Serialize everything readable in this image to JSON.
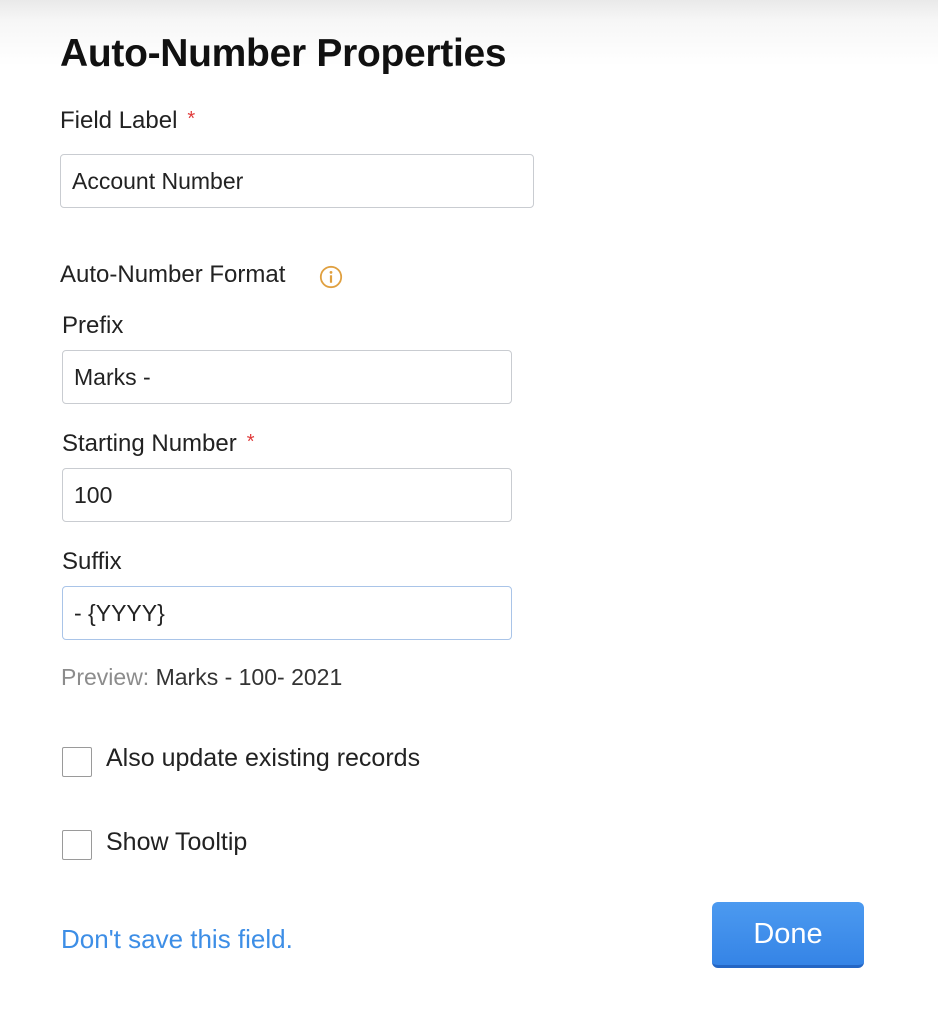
{
  "dialog": {
    "title": "Auto-Number Properties"
  },
  "field_label": {
    "label": "Field Label",
    "required_mark": "*",
    "value": "Account Number"
  },
  "format": {
    "heading": "Auto-Number Format",
    "info_icon": "info-circle-icon",
    "prefix": {
      "label": "Prefix",
      "value": "Marks -"
    },
    "starting_number": {
      "label": "Starting Number",
      "required_mark": "*",
      "value": "100"
    },
    "suffix": {
      "label": "Suffix",
      "value": "- {YYYY}"
    },
    "preview": {
      "label": "Preview:",
      "value": "Marks - 100- 2021"
    }
  },
  "options": {
    "update_existing": {
      "label": "Also update existing records",
      "checked": false
    },
    "show_tooltip": {
      "label": "Show Tooltip",
      "checked": false
    }
  },
  "footer": {
    "discard_link": "Don't save this field.",
    "done_label": "Done"
  },
  "colors": {
    "accent": "#3d8ee6",
    "required": "#e03a3a",
    "info_icon": "#e0a040",
    "button": "#3584e6"
  }
}
